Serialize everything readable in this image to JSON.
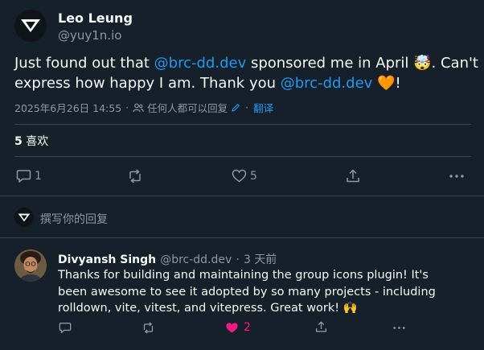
{
  "author": {
    "name": "Leo Leung",
    "handle": "@yuy1n.io"
  },
  "tweet": {
    "part1": "Just found out that ",
    "mention1": "@brc-dd.dev",
    "part2": " sponsored me in April 🤯. Can't express how happy I am. Thank you ",
    "mention2": "@brc-dd.dev",
    "part3": " 🧡!"
  },
  "meta": {
    "timestamp": "2025年6月26日 14:55",
    "dot1": "·",
    "audience_icon": "people-icon",
    "audience": "任何人都可以回复",
    "edit_icon": "pencil-icon",
    "dot2": "·",
    "translate": "翻译"
  },
  "likes": {
    "count": "5",
    "label": " 喜欢"
  },
  "actions": {
    "reply_count": "1",
    "repost_count": "",
    "like_count": "5"
  },
  "reply_prompt": {
    "label": "撰写你的回复"
  },
  "reply": {
    "author": "Divyansh Singh",
    "handle": "@brc-dd.dev",
    "dot": "·",
    "time": "3 天前",
    "text": "Thanks for building and maintaining the group icons plugin! It's been awesome to see it adopted by so many projects - including rolldown, vite, vitest, and vitepress. Great work! 🙌",
    "like_count": "2"
  },
  "colors": {
    "background": "#15202b",
    "accent": "#1d9bf0",
    "muted": "#8b98a5",
    "like": "#f91880",
    "divider": "#38444d"
  }
}
